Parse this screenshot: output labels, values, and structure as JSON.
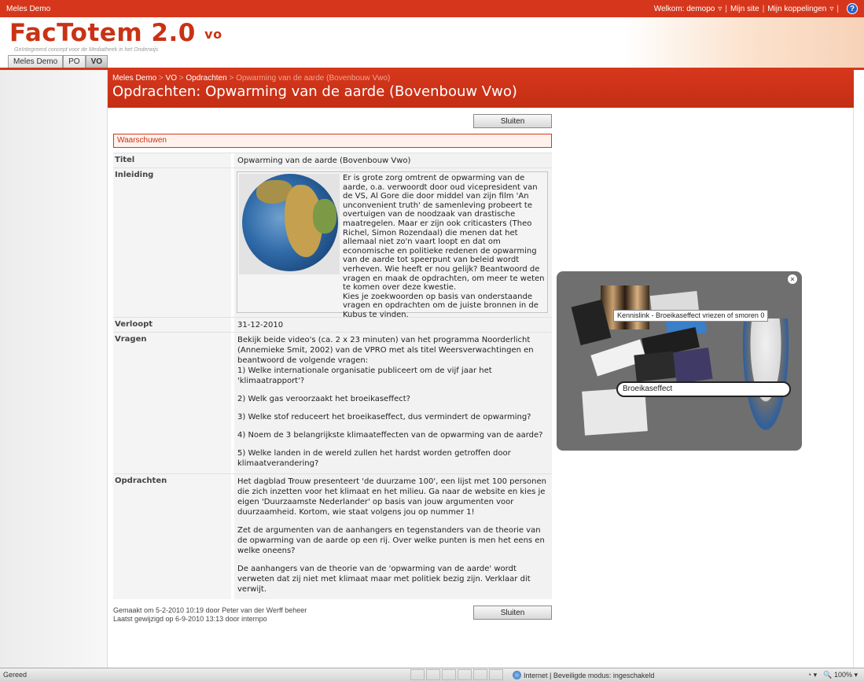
{
  "topbar": {
    "site": "Meles Demo",
    "welcome": "Welkom: demopo",
    "mysite": "Mijn site",
    "mylinks": "Mijn koppelingen",
    "help": "?"
  },
  "header": {
    "logo": "FacTotem 2.0",
    "logo_suffix": "vo",
    "tagline": "Geïntegreerd concept voor de Mediatheek in het Onderwijs",
    "tabs": [
      "Meles Demo",
      "PO",
      "VO"
    ]
  },
  "breadcrumb": {
    "root": "Meles Demo",
    "sep": " > ",
    "level1": "VO",
    "level2": "Opdrachten",
    "current": "Opwarming van de aarde (Bovenbouw Vwo)"
  },
  "page_title": "Opdrachten: Opwarming van de aarde (Bovenbouw Vwo)",
  "buttons": {
    "close": "Sluiten"
  },
  "warning": "Waarschuwen",
  "fields": {
    "title_label": "Titel",
    "title_value": "Opwarming van de aarde (Bovenbouw Vwo)",
    "intro_label": "Inleiding",
    "intro_text": "Er is grote zorg omtrent de opwarming van de aarde, o.a. verwoordt door oud vicepresident van de VS, Al Gore die door middel van zijn film 'An unconvenient truth' de samenleving probeert te overtuigen van de noodzaak van drastische maatregelen. Maar er zijn ook criticasters (Theo Richel, Simon Rozendaal) die menen dat het allemaal niet zo'n vaart loopt en dat om economische en politieke redenen de opwarming van de aarde tot speerpunt van beleid wordt verheven. Wie heeft er nou gelijk? Beantwoord de vragen en maak de opdrachten, om meer te weten te komen over deze kwestie.",
    "intro_text2": "Kies je zoekwoorden op basis van onderstaande vragen en opdrachten om de juiste bronnen in de Kubus te vinden.",
    "expires_label": "Verloopt",
    "expires_value": "31-12-2010",
    "questions_label": "Vragen",
    "questions": [
      "Bekijk beide video's (ca. 2 x 23 minuten) van het programma Noorderlicht (Annemieke Smit, 2002) van de VPRO met als titel Weersverwachtingen en beantwoord de volgende vragen:",
      "1) Welke internationale organisatie publiceert om de vijf jaar het 'klimaatrapport'?",
      "2) Welk gas veroorzaakt het broeikaseffect?",
      "3) Welke stof reduceert het broeikaseffect, dus vermindert de opwarming?",
      "4) Noem de 3 belangrijkste klimaateffecten van de opwarming van de aarde?",
      "5) Welke landen in de wereld zullen het hardst worden getroffen door klimaatverandering?"
    ],
    "tasks_label": "Opdrachten",
    "tasks": [
      "Het dagblad Trouw presenteert 'de duurzame 100', een lijst met 100 personen die zich inzetten voor het klimaat en het milieu. Ga naar de website en kies je eigen 'Duurzaamste Nederlander' op basis van jouw argumenten voor duurzaamheid. Kortom, wie staat volgens jou op nummer 1!",
      "Zet de argumenten van de aanhangers en tegenstanders van de theorie van de opwarming van de aarde op een rij. Over welke punten is men het eens en welke oneens?",
      "De aanhangers van de theorie van de 'opwarming van de aarde' wordt verweten dat zij niet met klimaat maar met politiek bezig zijn. Verklaar dit verwijt."
    ]
  },
  "meta": {
    "created": "Gemaakt om 5-2-2010 10:19  door Peter van der Werff beheer",
    "modified": "Laatst gewijzigd op 6-9-2010 13:13  door internpo"
  },
  "popup": {
    "tooltip": "Kennislink - Broeikaseffect vriezen of smoren 0",
    "search_value": "Broeikaseffect",
    "close": "×"
  },
  "statusbar": {
    "left": "Gereed",
    "zone": "Internet | Beveiligde modus: ingeschakeld",
    "zoom": "100%"
  },
  "colors": {
    "brand": "#d6371c",
    "warning_bg": "#fff2ec"
  }
}
